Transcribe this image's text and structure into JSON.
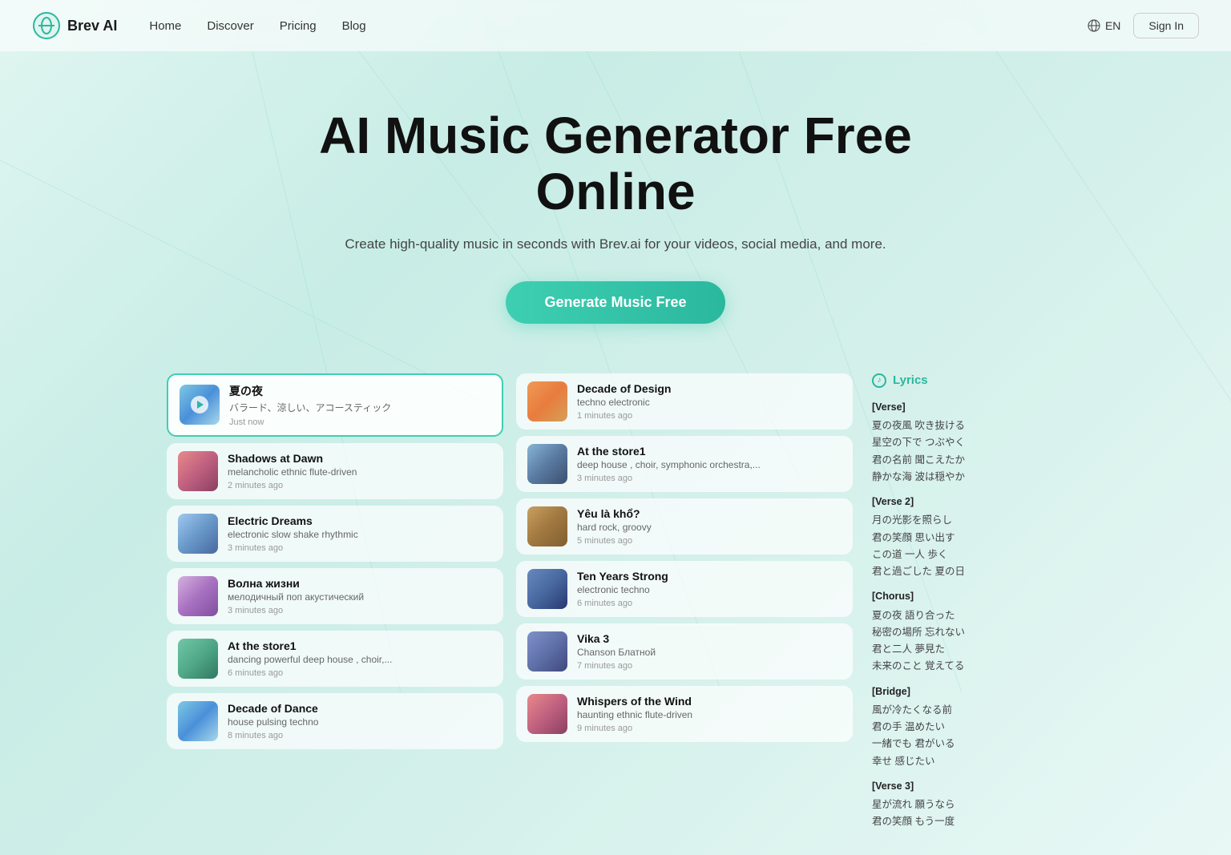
{
  "nav": {
    "logo": "Brev AI",
    "links": [
      {
        "label": "Home",
        "id": "home"
      },
      {
        "label": "Discover",
        "id": "discover"
      },
      {
        "label": "Pricing",
        "id": "pricing"
      },
      {
        "label": "Blog",
        "id": "blog"
      }
    ],
    "lang": "EN",
    "sign_in": "Sign In"
  },
  "hero": {
    "title_line1": "AI Music Generator Free",
    "title_line2": "Online",
    "subtitle": "Create high-quality music in seconds with Brev.ai for your videos, social media, and more.",
    "cta": "Generate Music Free"
  },
  "tracks_left": [
    {
      "id": "1",
      "title": "夏の夜",
      "subtitle": "バラード、涼しい、アコースティック",
      "time": "Just now",
      "thumb": "thumb-gradient-1",
      "active": true,
      "show_play": true
    },
    {
      "id": "3",
      "title": "Shadows at Dawn",
      "subtitle": "melancholic ethnic flute-driven",
      "time": "2 minutes ago",
      "thumb": "thumb-gradient-3",
      "active": false,
      "show_play": false
    },
    {
      "id": "5",
      "title": "Electric Dreams",
      "subtitle": "electronic slow shake rhythmic",
      "time": "3 minutes ago",
      "thumb": "thumb-gradient-5",
      "active": false,
      "show_play": false
    },
    {
      "id": "7",
      "title": "Волна жизни",
      "subtitle": "мелодичный поп акустический",
      "time": "3 minutes ago",
      "thumb": "thumb-gradient-7",
      "active": false,
      "show_play": false
    },
    {
      "id": "9",
      "title": "At the store1",
      "subtitle": "dancing powerful deep house , choir,...",
      "time": "6 minutes ago",
      "thumb": "thumb-gradient-9",
      "active": false,
      "show_play": false
    },
    {
      "id": "11",
      "title": "Decade of Dance",
      "subtitle": "house pulsing techno",
      "time": "8 minutes ago",
      "thumb": "thumb-gradient-1",
      "active": false,
      "show_play": false
    }
  ],
  "tracks_right": [
    {
      "id": "2",
      "title": "Decade of Design",
      "subtitle": "techno electronic",
      "time": "1 minutes ago",
      "thumb": "thumb-gradient-2",
      "active": false,
      "show_play": false
    },
    {
      "id": "4",
      "title": "At the store1",
      "subtitle": "deep house , choir, symphonic orchestra,...",
      "time": "3 minutes ago",
      "thumb": "thumb-gradient-4",
      "active": false,
      "show_play": false
    },
    {
      "id": "6",
      "title": "Yêu là khổ?",
      "subtitle": "hard rock, groovy",
      "time": "5 minutes ago",
      "thumb": "thumb-gradient-6",
      "active": false,
      "show_play": false
    },
    {
      "id": "8",
      "title": "Ten Years Strong",
      "subtitle": "electronic techno",
      "time": "6 minutes ago",
      "thumb": "thumb-gradient-8",
      "active": false,
      "show_play": false
    },
    {
      "id": "10",
      "title": "Vika 3",
      "subtitle": "Chanson Блатной",
      "time": "7 minutes ago",
      "thumb": "thumb-gradient-10",
      "active": false,
      "show_play": false
    },
    {
      "id": "12",
      "title": "Whispers of the Wind",
      "subtitle": "haunting ethnic flute-driven",
      "time": "9 minutes ago",
      "thumb": "thumb-gradient-3",
      "active": false,
      "show_play": false
    }
  ],
  "lyrics": {
    "header": "Lyrics",
    "sections": [
      {
        "title": "[Verse]",
        "lines": [
          "夏の夜風 吹き抜ける",
          "星空の下で つぶやく",
          "君の名前 聞こえたか",
          "静かな海 波は穏やか"
        ]
      },
      {
        "title": "[Verse 2]",
        "lines": [
          "月の光影を照らし",
          "君の笑顔 思い出す",
          "この道 一人 歩く",
          "君と過ごした 夏の日"
        ]
      },
      {
        "title": "[Chorus]",
        "lines": [
          "夏の夜 語り合った",
          "秘密の場所 忘れない",
          "君と二人 夢見た",
          "未来のこと 覚えてる"
        ]
      },
      {
        "title": "[Bridge]",
        "lines": [
          "風が冷たくなる前",
          "君の手 温めたい",
          "一緒でも 君がいる",
          "幸せ 感じたい"
        ]
      },
      {
        "title": "[Verse 3]",
        "lines": [
          "星が流れ 願うなら",
          "君の笑顔 もう一度"
        ]
      }
    ]
  }
}
